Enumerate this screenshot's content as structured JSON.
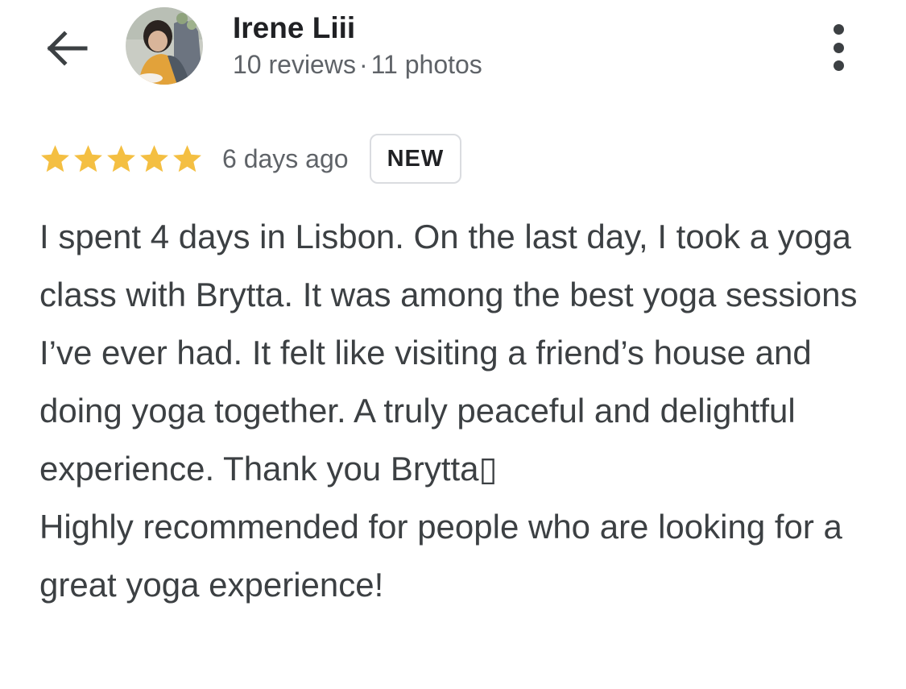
{
  "header": {
    "back_icon": "arrow-back-icon",
    "avatar_icon": "profile-photo",
    "reviewer_name": "Irene Liii",
    "review_count": "10 reviews",
    "separator": "·",
    "photo_count": "11 photos",
    "more_icon": "more-vert-icon"
  },
  "review": {
    "rating": 5,
    "rating_max": 5,
    "star_color": "#f4bf42",
    "date": "6 days ago",
    "badge": "NEW",
    "paragraphs": [
      "I spent 4 days in Lisbon. On the last day, I took a yoga class with Brytta. It was among the best yoga sessions I’ve ever had. It felt like visiting a friend’s house and doing yoga together. A truly peaceful and delightful experience. Thank you Brytta▯",
      "Highly recommended for people who are looking for a great yoga experience!"
    ]
  }
}
